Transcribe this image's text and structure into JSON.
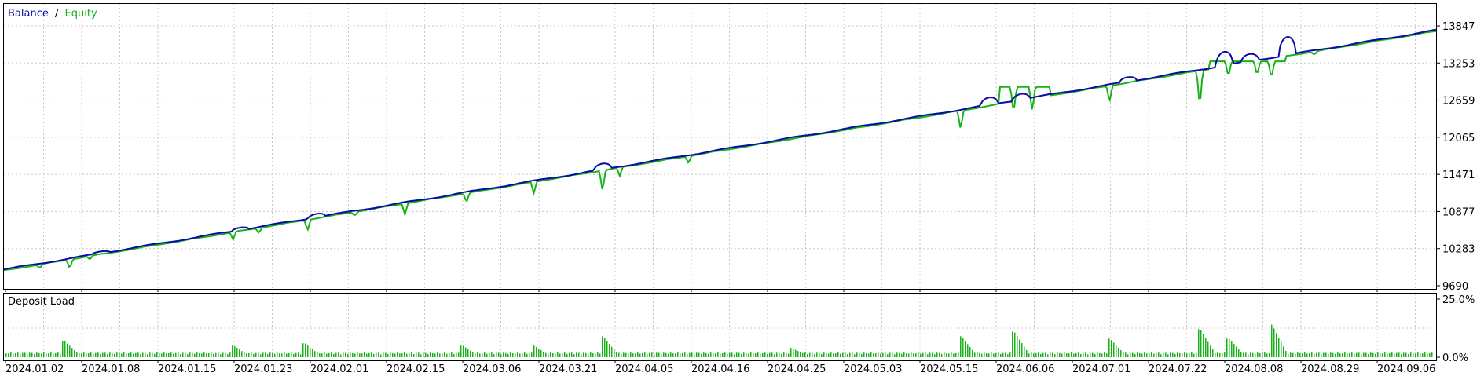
{
  "legend": {
    "balance_label": "Balance",
    "separator": "/",
    "equity_label": "Equity"
  },
  "sub_panel": {
    "title": "Deposit Load"
  },
  "colors": {
    "balance": "#0a0aa8",
    "equity": "#16b316",
    "load": "#16b316",
    "grid": "#c8c8c8",
    "frame": "#000000"
  },
  "chart_data": [
    {
      "type": "line",
      "y_ticks": [
        "13847",
        "13253",
        "12659",
        "12065",
        "11471",
        "10877",
        "10283",
        "9690"
      ],
      "ylim": [
        9690,
        13847
      ],
      "x_ticks": [
        "2024.01.02",
        "2024.01.08",
        "2024.01.15",
        "2024.01.23",
        "2024.02.01",
        "2024.02.15",
        "2024.03.06",
        "2024.03.21",
        "2024.04.05",
        "2024.04.16",
        "2024.04.25",
        "2024.05.03",
        "2024.05.15",
        "2024.06.06",
        "2024.07.01",
        "2024.07.22",
        "2024.08.08",
        "2024.08.29",
        "2024.09.06"
      ],
      "series": [
        {
          "name": "Balance",
          "start": 9950,
          "end": 13780
        },
        {
          "name": "Equity",
          "start": 9940,
          "end": 13775
        }
      ],
      "balance_bumps": [
        {
          "x": 0.068,
          "h": 30
        },
        {
          "x": 0.165,
          "h": 45
        },
        {
          "x": 0.218,
          "h": 60
        },
        {
          "x": 0.418,
          "h": 85
        },
        {
          "x": 0.688,
          "h": 110
        },
        {
          "x": 0.71,
          "h": 95
        },
        {
          "x": 0.785,
          "h": 70
        },
        {
          "x": 0.852,
          "h": 220
        },
        {
          "x": 0.87,
          "h": 110
        },
        {
          "x": 0.896,
          "h": 290
        }
      ],
      "equity_dips": [
        {
          "x": 0.025,
          "d": 60
        },
        {
          "x": 0.046,
          "d": 140
        },
        {
          "x": 0.06,
          "d": 50
        },
        {
          "x": 0.16,
          "d": 120
        },
        {
          "x": 0.178,
          "d": 80
        },
        {
          "x": 0.212,
          "d": 170
        },
        {
          "x": 0.245,
          "d": 60
        },
        {
          "x": 0.28,
          "d": 170
        },
        {
          "x": 0.323,
          "d": 150
        },
        {
          "x": 0.37,
          "d": 180
        },
        {
          "x": 0.418,
          "d": 330
        },
        {
          "x": 0.43,
          "d": 140
        },
        {
          "x": 0.478,
          "d": 110
        },
        {
          "x": 0.668,
          "d": 300
        },
        {
          "x": 0.705,
          "d": 420
        },
        {
          "x": 0.718,
          "d": 400
        },
        {
          "x": 0.772,
          "d": 250
        },
        {
          "x": 0.835,
          "d": 590
        },
        {
          "x": 0.855,
          "d": 250
        },
        {
          "x": 0.875,
          "d": 230
        },
        {
          "x": 0.885,
          "d": 280
        },
        {
          "x": 0.915,
          "d": 50
        }
      ],
      "equity_flat_segments": [
        {
          "from": 0.695,
          "to": 0.73,
          "value": 12870
        },
        {
          "from": 0.842,
          "to": 0.895,
          "value": 13280
        }
      ]
    },
    {
      "type": "bar",
      "title": "Deposit Load",
      "y_ticks": [
        "25.0%",
        "0.0%"
      ],
      "ylim": [
        0,
        25
      ],
      "baseline": 2,
      "spikes": [
        {
          "x": 0.042,
          "v": 7
        },
        {
          "x": 0.16,
          "v": 5
        },
        {
          "x": 0.21,
          "v": 6
        },
        {
          "x": 0.32,
          "v": 5
        },
        {
          "x": 0.37,
          "v": 5
        },
        {
          "x": 0.418,
          "v": 9
        },
        {
          "x": 0.55,
          "v": 4
        },
        {
          "x": 0.668,
          "v": 9
        },
        {
          "x": 0.705,
          "v": 11
        },
        {
          "x": 0.772,
          "v": 8
        },
        {
          "x": 0.835,
          "v": 12
        },
        {
          "x": 0.855,
          "v": 8
        },
        {
          "x": 0.885,
          "v": 14
        }
      ]
    }
  ]
}
